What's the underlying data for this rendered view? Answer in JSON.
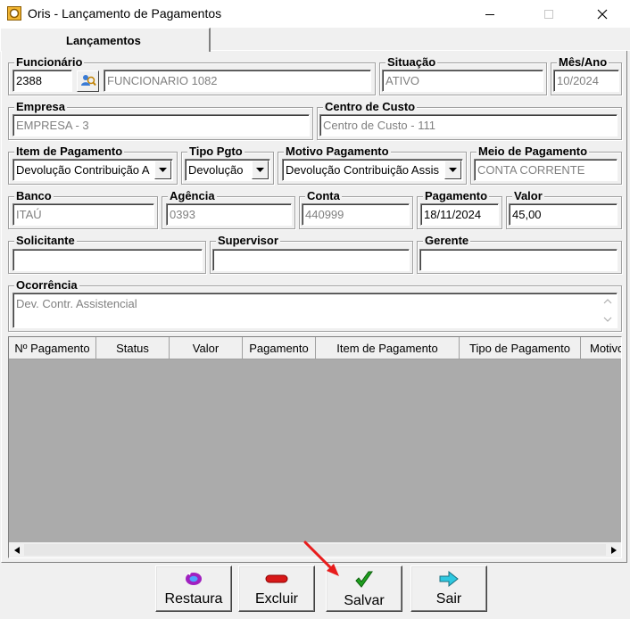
{
  "window": {
    "title": "Oris - Lançamento de Pagamentos"
  },
  "tabs": [
    {
      "label": "Lançamentos"
    }
  ],
  "form": {
    "funcionario": {
      "label": "Funcionário",
      "code": "2388",
      "name": "FUNCIONARIO 1082"
    },
    "situacao": {
      "label": "Situação",
      "value": "ATIVO"
    },
    "mes_ano": {
      "label": "Mês/Ano",
      "value": "10/2024"
    },
    "empresa": {
      "label": "Empresa",
      "value": "EMPRESA - 3"
    },
    "centro_custo": {
      "label": "Centro de Custo",
      "value": "Centro de Custo - 111"
    },
    "item_pagamento": {
      "label": "Item de Pagamento",
      "value": "Devolução Contribuição A"
    },
    "tipo_pgto": {
      "label": "Tipo Pgto",
      "value": "Devolução"
    },
    "motivo_pagamento": {
      "label": "Motivo Pagamento",
      "value": "Devolução Contribuição Assis"
    },
    "meio_pagamento": {
      "label": "Meio de Pagamento",
      "value": "CONTA CORRENTE"
    },
    "banco": {
      "label": "Banco",
      "value": "ITAÚ"
    },
    "agencia": {
      "label": "Agência",
      "value": "0393"
    },
    "conta": {
      "label": "Conta",
      "value": "440999"
    },
    "pagamento": {
      "label": "Pagamento",
      "value": "18/11/2024"
    },
    "valor": {
      "label": "Valor",
      "value": "45,00"
    },
    "solicitante": {
      "label": "Solicitante",
      "value": ""
    },
    "supervisor": {
      "label": "Supervisor",
      "value": ""
    },
    "gerente": {
      "label": "Gerente",
      "value": ""
    },
    "ocorrencia": {
      "label": "Ocorrência",
      "value": "Dev. Contr. Assistencial"
    }
  },
  "grid": {
    "columns": [
      "Nº Pagamento",
      "Status",
      "Valor",
      "Pagamento",
      "Item de Pagamento",
      "Tipo de Pagamento",
      "Motivo"
    ]
  },
  "buttons": {
    "restaura": "Restaura",
    "excluir": "Excluir",
    "salvar": "Salvar",
    "sair": "Sair"
  },
  "colors": {
    "annotation_arrow": "#e81c1c",
    "grid_bg": "#ababab",
    "window_bg": "#f0f0f0"
  }
}
